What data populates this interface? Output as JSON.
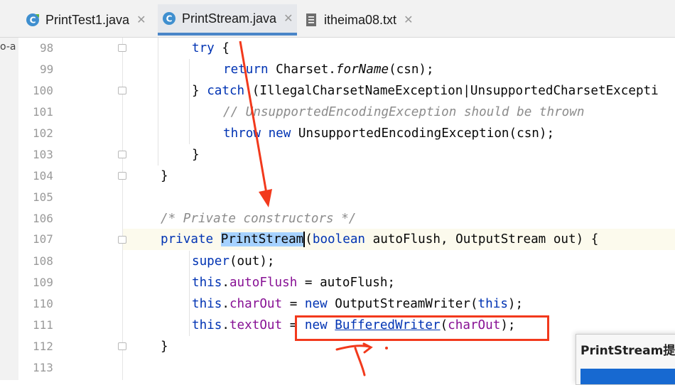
{
  "tabs": [
    {
      "label": "PrintTest1.java",
      "icon": "java-class-icon",
      "active": false
    },
    {
      "label": "PrintStream.java",
      "icon": "java-class-icon",
      "active": true
    },
    {
      "label": "itheima08.txt",
      "icon": "text-file-icon",
      "active": false
    }
  ],
  "tab_close_glyph": "✕",
  "side_strip_text": "o-a",
  "line_numbers": [
    "98",
    "99",
    "100",
    "101",
    "102",
    "103",
    "104",
    "105",
    "106",
    "107",
    "108",
    "109",
    "110",
    "111",
    "112",
    "113"
  ],
  "code": {
    "l98": {
      "kw": "try",
      "rest": " {"
    },
    "l99": {
      "kw": "return",
      "mid": " Charset.",
      "method": "forName",
      "rest": "(csn);"
    },
    "l100": {
      "pre": "} ",
      "kw": "catch",
      "rest": " (IllegalCharsetNameException|UnsupportedCharsetExcepti"
    },
    "l101": {
      "comment": "// UnsupportedEncodingException should be thrown"
    },
    "l102": {
      "kw1": "throw",
      "kw2": "new",
      "rest": " UnsupportedEncodingException(csn);"
    },
    "l103": {
      "text": "}"
    },
    "l104": {
      "text": "}"
    },
    "l106": {
      "comment": "/* Private constructors */"
    },
    "l107": {
      "kw": "private",
      "name": "PrintStream",
      "paren": "(",
      "kw2": "boolean",
      "rest": " autoFlush, OutputStream out) {"
    },
    "l108": {
      "kw": "super",
      "rest": "(out);"
    },
    "l109": {
      "kw": "this",
      "dot": ".",
      "field": "autoFlush",
      "rest": " = autoFlush;"
    },
    "l110": {
      "kw": "this",
      "dot": ".",
      "field": "charOut",
      "mid": " = ",
      "kw2": "new",
      "mid2": " OutputStreamWriter(",
      "kw3": "this",
      "rest": ");"
    },
    "l111": {
      "kw": "this",
      "dot": ".",
      "field": "textOut",
      "mid": " = ",
      "kw2": "new",
      "link": "BufferedWriter",
      "paren": "(",
      "field2": "charOut",
      "rest": ");"
    },
    "l112": {
      "text": "}"
    }
  },
  "popup": {
    "title": "PrintStream提"
  },
  "colors": {
    "keyword": "#0033b3",
    "field": "#871094",
    "comment": "#8c8c8c",
    "annotation_red": "#f2391c",
    "selection": "#a6d2ff"
  }
}
